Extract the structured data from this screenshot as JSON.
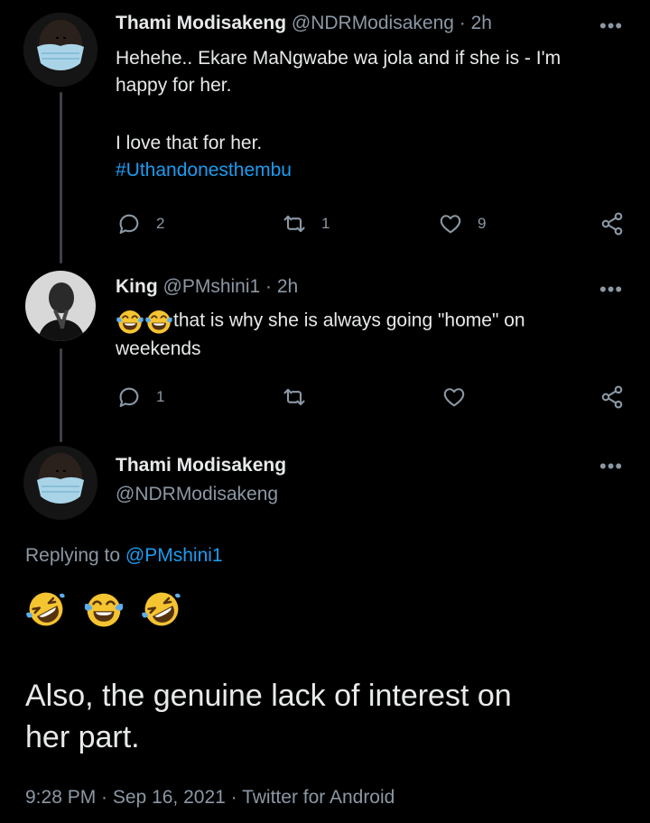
{
  "tweet1": {
    "name": "Thami Modisakeng",
    "handle": "@NDRModisakeng",
    "time": "· 2h",
    "more": "•••",
    "line1": "Hehehe.. Ekare MaNgwabe wa jola and if she is - I'm",
    "line2": "happy for her.",
    "line3": "I love that for her.",
    "hashtag": "#Uthandonesthembu",
    "replies": "2",
    "retweets": "1",
    "likes": "9"
  },
  "tweet2": {
    "name": "King",
    "handle": "@PMshini1",
    "time": "· 2h",
    "more": "•••",
    "line1": "that is why she is always going \"home\" on",
    "line2": "weekends",
    "replies": "1",
    "retweets": "",
    "likes": ""
  },
  "main": {
    "name": "Thami Modisakeng",
    "handle": "@NDRModisakeng",
    "more": "•••",
    "replying_prefix": "Replying to",
    "replying_handle": "@PMshini1",
    "text_line1": "Also, the genuine lack of interest on",
    "text_line2": "her part.",
    "timestamp": "9:28 PM · Sep 16, 2021 · Twitter for Android"
  },
  "icons": {
    "reply": "reply-icon",
    "retweet": "retweet-icon",
    "like": "heart-icon",
    "share": "share-icon",
    "emoji_rofl": "rolling-on-floor-laughing-emoji",
    "emoji_tears": "tears-of-joy-emoji"
  },
  "colors": {
    "background": "#000000",
    "text": "#e7e9ea",
    "secondary": "#8b98a5",
    "accent": "#1d9bf0",
    "thread_line": "#3d4248"
  }
}
